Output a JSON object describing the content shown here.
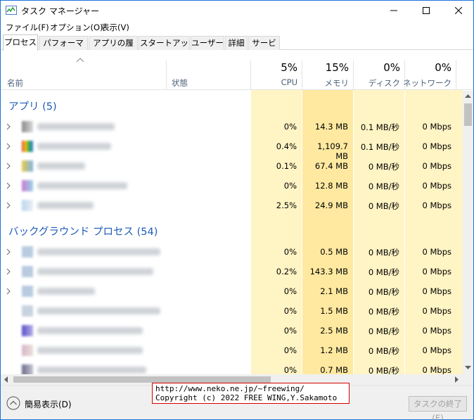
{
  "window": {
    "title": "タスク マネージャー"
  },
  "menu": [
    "ファイル(F)",
    "オプション(O)",
    "表示(V)"
  ],
  "tabs": [
    "プロセス",
    "パフォーマンス",
    "アプリの履歴",
    "スタートアップ",
    "ユーザー",
    "詳細",
    "サービス"
  ],
  "active_tab": "プロセス",
  "columns": {
    "name": "名前",
    "status": "状態",
    "cpu": {
      "pct": "5%",
      "label": "CPU"
    },
    "memory": {
      "pct": "15%",
      "label": "メモリ"
    },
    "disk": {
      "pct": "0%",
      "label": "ディスク"
    },
    "network": {
      "pct": "0%",
      "label": "ネットワーク"
    }
  },
  "groups": {
    "apps": {
      "title": "アプリ (5)",
      "rows": [
        {
          "cpu": "0%",
          "mem": "14.3 MB",
          "disk": "0.1 MB/秒",
          "net": "0 Mbps"
        },
        {
          "cpu": "0.4%",
          "mem": "1,109.7 MB",
          "disk": "0.1 MB/秒",
          "net": "0 Mbps"
        },
        {
          "cpu": "0.1%",
          "mem": "67.4 MB",
          "disk": "0 MB/秒",
          "net": "0 Mbps"
        },
        {
          "cpu": "0%",
          "mem": "12.8 MB",
          "disk": "0 MB/秒",
          "net": "0 Mbps"
        },
        {
          "cpu": "2.5%",
          "mem": "24.9 MB",
          "disk": "0 MB/秒",
          "net": "0 Mbps"
        }
      ]
    },
    "background": {
      "title": "バックグラウンド プロセス (54)",
      "rows": [
        {
          "cpu": "0%",
          "mem": "0.5 MB",
          "disk": "0 MB/秒",
          "net": "0 Mbps"
        },
        {
          "cpu": "0.2%",
          "mem": "143.3 MB",
          "disk": "0 MB/秒",
          "net": "0 Mbps"
        },
        {
          "cpu": "0%",
          "mem": "2.1 MB",
          "disk": "0 MB/秒",
          "net": "0 Mbps"
        },
        {
          "cpu": "0%",
          "mem": "1.5 MB",
          "disk": "0 MB/秒",
          "net": "0 Mbps"
        },
        {
          "cpu": "0%",
          "mem": "2.5 MB",
          "disk": "0 MB/秒",
          "net": "0 Mbps"
        },
        {
          "cpu": "0%",
          "mem": "1.2 MB",
          "disk": "0 MB/秒",
          "net": "0 Mbps"
        },
        {
          "cpu": "0%",
          "mem": "0.7 MB",
          "disk": "0 MB/秒",
          "net": "0 Mbps"
        }
      ]
    }
  },
  "footer": {
    "fewer_details": "簡易表示(D)",
    "end_task": "タスクの終了(E)"
  },
  "watermark": {
    "line1": "http://www.neko.ne.jp/~freewing/",
    "line2": "Copyright (c) 2022 FREE WING,Y.Sakamoto"
  },
  "colors": {
    "accent": "#1e5bb8",
    "cell_light": "#fff4c4",
    "cell_mid": "#ffe9a0"
  }
}
